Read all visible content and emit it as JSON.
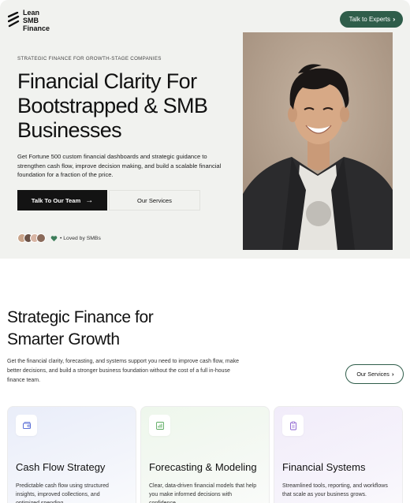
{
  "brand": {
    "logo_lines": [
      "Lean",
      "SMB",
      "Finance"
    ]
  },
  "header": {
    "cta_label": "Talk to Experts"
  },
  "hero": {
    "eyebrow": "STRATEGIC FINANCE FOR GROWTH-STAGE COMPANIES",
    "title": "Financial Clarity For Bootstrapped & SMB Businesses",
    "description": "Get Fortune 500 custom financial dashboards and strategic guidance to strengthen cash flow, improve decision making, and build a scalable financial foundation for a fraction of the price.",
    "primary_button": "Talk To Our Team",
    "secondary_button": "Our Services",
    "social_proof": "• Loved by SMBs"
  },
  "section": {
    "title": "Strategic Finance for Smarter Growth",
    "description": "Get the financial clarity, forecasting, and systems support you need to improve cash flow, make better decisions, and build a stronger business foundation without the cost of a full in-house finance team.",
    "button": "Our Services",
    "cards": [
      {
        "title": "Cash Flow Strategy",
        "description": "Predictable cash flow using structured insights, improved collections, and optimized spending.",
        "icon": "wallet-icon"
      },
      {
        "title": "Forecasting & Modeling",
        "description": "Clear, data-driven financial models that help you make informed decisions with confidence.",
        "icon": "bar-chart-icon"
      },
      {
        "title": "Financial Systems",
        "description": "Streamlined tools, reporting, and workflows that scale as your business grows.",
        "icon": "clipboard-icon"
      }
    ]
  },
  "colors": {
    "accent_green": "#2f5d4a",
    "hero_bg": "#f1f2ef",
    "dark_button": "#131313"
  }
}
